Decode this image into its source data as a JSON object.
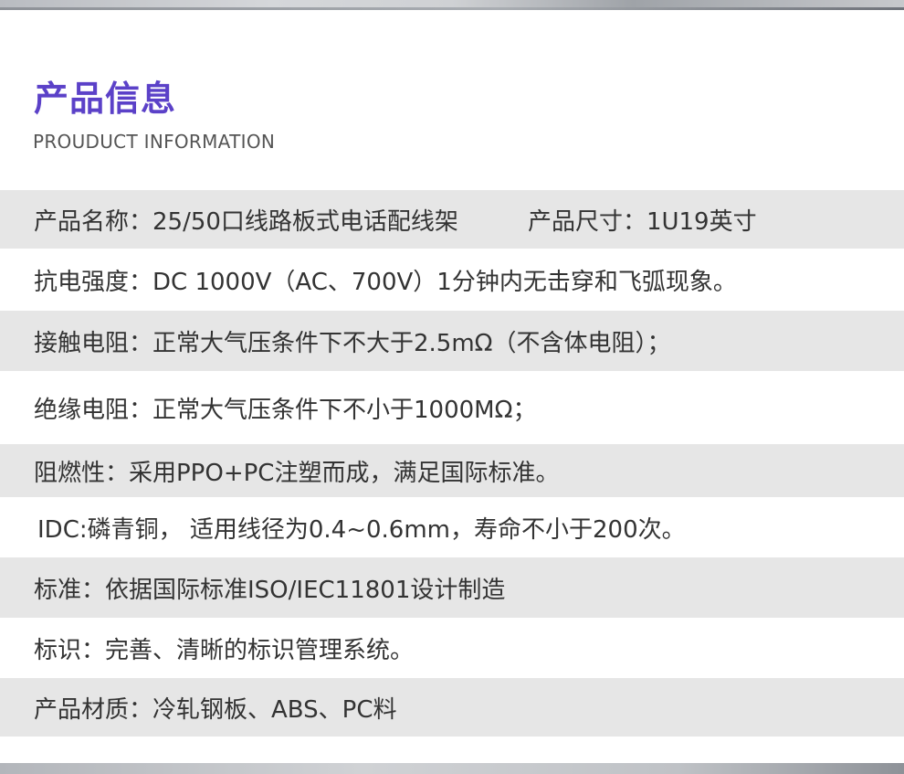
{
  "header": {
    "title": "产品信息",
    "subtitle": "PROUDUCT INFORMATION"
  },
  "specs": {
    "name": "产品名称：25/50口线路板式电话配线架",
    "size": "产品尺寸：1U19英寸",
    "dielectric": "抗电强度：DC 1000V（AC、700V）1分钟内无击穿和飞弧现象。",
    "contact_resistance": "接触电阻：正常大气压条件下不大于2.5mΩ（不含体电阻）；",
    "insulation_resistance": "绝缘电阻：正常大气压条件下不小于1000MΩ；",
    "flame_retardant": "阻燃性：采用PPO+PC注塑而成，满足国际标准。",
    "idc": "IDC:磷青铜， 适用线径为0.4~0.6mm，寿命不小于200次。",
    "standard": "标准：依据国际标准ISO/IEC11801设计制造",
    "marking": "标识：完善、清晰的标识管理系统。",
    "material": "产品材质：冷轧钢板、ABS、PC料"
  }
}
